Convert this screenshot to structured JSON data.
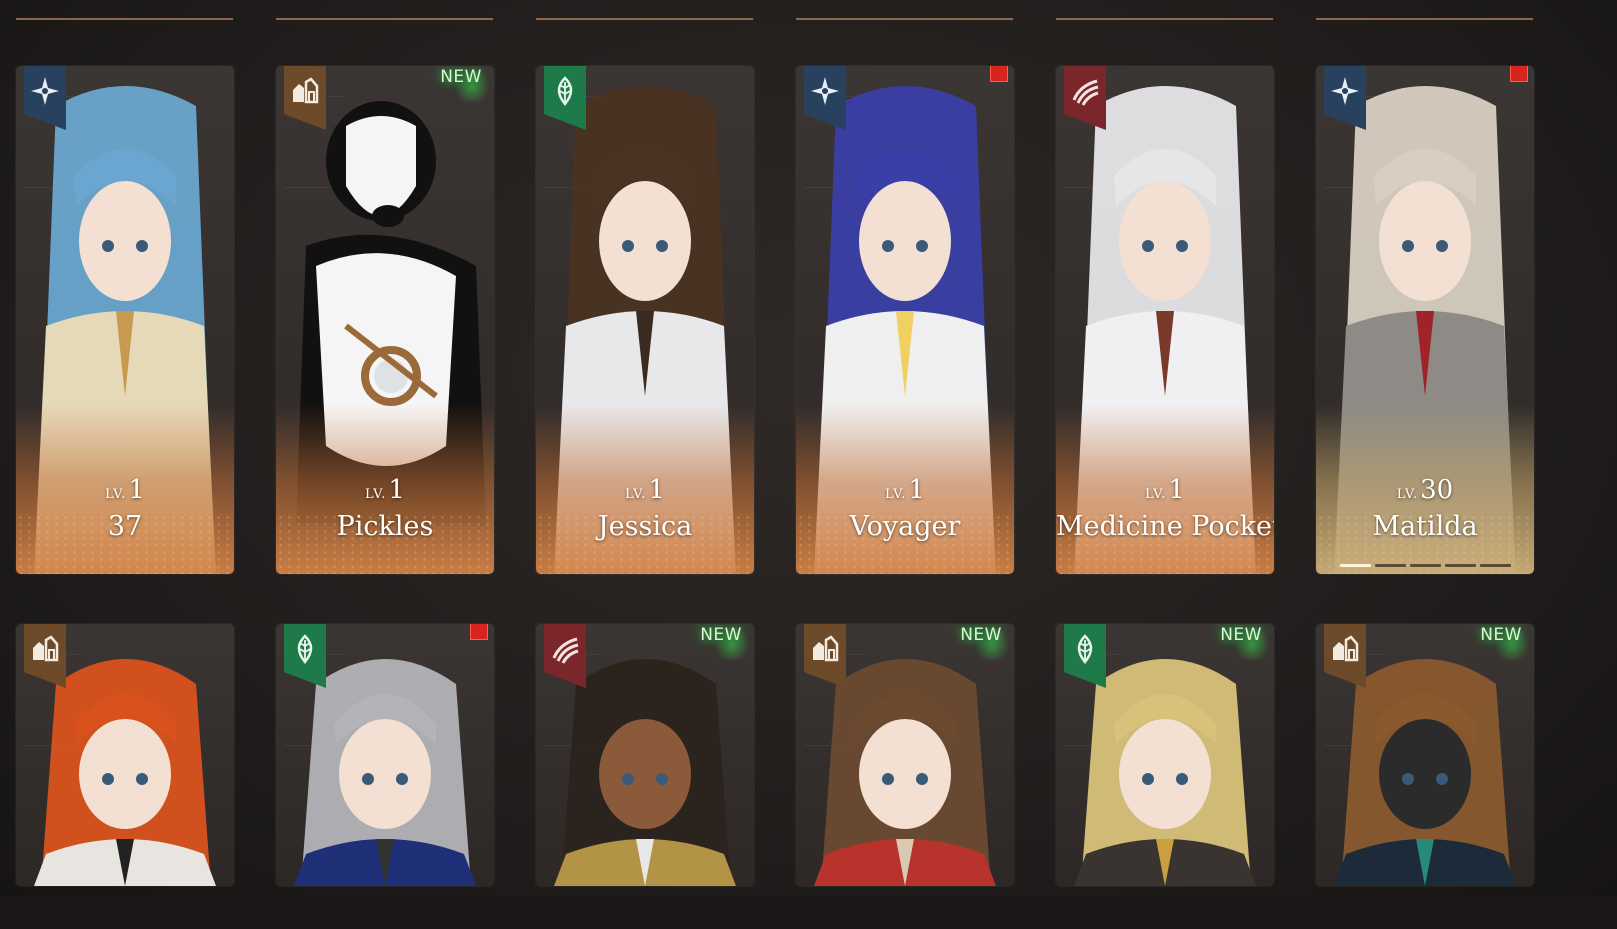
{
  "lv_prefix": "LV.",
  "new_label": "NEW",
  "colors": {
    "card_fade_orange": "#d2824a",
    "card_fade_gold": "#cdaf78",
    "badge_star": "#27415f",
    "badge_beast": "#6d4a2a",
    "badge_mineral": "#1f7a4a",
    "badge_claw": "#7a262a",
    "new_glow": "#2dc24a",
    "red_dot": "#d8241e"
  },
  "row1": [
    {
      "name": "37",
      "level": "1",
      "afflatus_icon": "star-icon",
      "new": false,
      "red_dot": false,
      "palette": {
        "hair": "#6aa6cf",
        "skin": "#f3e0d2",
        "outfit": "#e6d9b8",
        "accent": "#c79a52"
      }
    },
    {
      "name": "Pickles",
      "level": "1",
      "afflatus_icon": "beast-icon",
      "new": true,
      "red_dot": false,
      "palette": {
        "hair": "#111111",
        "skin": "#f2f2f2",
        "outfit": "#f5f5f5",
        "accent": "#9a6a3a"
      }
    },
    {
      "name": "Jessica",
      "level": "1",
      "afflatus_icon": "mineral-icon",
      "new": false,
      "red_dot": false,
      "palette": {
        "hair": "#4a3322",
        "skin": "#f3e0d2",
        "outfit": "#e8e8ea",
        "accent": "#3a2a20"
      }
    },
    {
      "name": "Voyager",
      "level": "1",
      "afflatus_icon": "star-icon",
      "new": false,
      "red_dot": true,
      "palette": {
        "hair": "#3a3fa8",
        "skin": "#f3e0d2",
        "outfit": "#efefef",
        "accent": "#f0d060"
      }
    },
    {
      "name": "Medicine Pocket",
      "level": "1",
      "afflatus_icon": "claw-icon",
      "new": false,
      "red_dot": false,
      "palette": {
        "hair": "#e6e6e8",
        "skin": "#f3e0d2",
        "outfit": "#f0f0f2",
        "accent": "#7a3a2a"
      }
    },
    {
      "name": "Matilda",
      "level": "30",
      "afflatus_icon": "star-icon",
      "new": false,
      "red_dot": true,
      "gold": true,
      "pips_filled": 1,
      "pips_total": 5,
      "palette": {
        "hair": "#d8cfc2",
        "skin": "#f3e0d2",
        "outfit": "#8e8a86",
        "accent": "#a0232a"
      }
    }
  ],
  "row2": [
    {
      "afflatus_icon": "beast-icon",
      "new": false,
      "red_dot": false,
      "palette": {
        "hair": "#d9521e",
        "skin": "#f3e0d2",
        "outfit": "#e8e4e0",
        "accent": "#222"
      }
    },
    {
      "afflatus_icon": "mineral-icon",
      "new": false,
      "red_dot": true,
      "palette": {
        "hair": "#b4b4b8",
        "skin": "#f3e0d2",
        "outfit": "#1f2f78",
        "accent": "#333"
      }
    },
    {
      "afflatus_icon": "claw-icon",
      "new": true,
      "red_dot": false,
      "palette": {
        "hair": "#2b231c",
        "skin": "#8a5a3a",
        "outfit": "#b39447",
        "accent": "#e8e8e8"
      }
    },
    {
      "afflatus_icon": "beast-icon",
      "new": true,
      "red_dot": false,
      "palette": {
        "hair": "#6b4a30",
        "skin": "#f3e0d2",
        "outfit": "#b8332c",
        "accent": "#d9c9b0"
      }
    },
    {
      "afflatus_icon": "mineral-icon",
      "new": true,
      "red_dot": false,
      "palette": {
        "hair": "#d8c27a",
        "skin": "#f3e0d2",
        "outfit": "#3a3430",
        "accent": "#c8a040"
      }
    },
    {
      "afflatus_icon": "beast-icon",
      "new": true,
      "red_dot": false,
      "palette": {
        "hair": "#8a5a2e",
        "skin": "#2b2b2b",
        "outfit": "#1c2a3a",
        "accent": "#2a8a7a"
      }
    }
  ]
}
